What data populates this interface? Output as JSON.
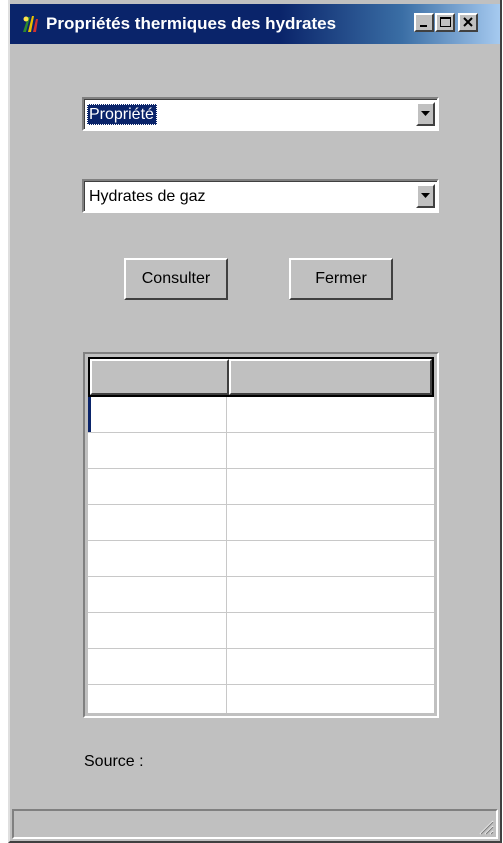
{
  "window": {
    "title": "Propriétés thermiques des hydrates",
    "icon": "app-logo-icon",
    "controls": [
      "minimize-icon",
      "maximize-icon",
      "close-icon"
    ]
  },
  "form": {
    "property_select": {
      "value": "Propriété",
      "selected": true
    },
    "category_select": {
      "value": "Hydrates de gaz"
    },
    "consult_button": "Consulter",
    "close_button": "Fermer"
  },
  "grid": {
    "headers": [
      "",
      ""
    ],
    "rows": [
      [
        "",
        ""
      ],
      [
        "",
        ""
      ],
      [
        "",
        ""
      ],
      [
        "",
        ""
      ],
      [
        "",
        ""
      ],
      [
        "",
        ""
      ],
      [
        "",
        ""
      ],
      [
        "",
        ""
      ],
      [
        "",
        ""
      ]
    ]
  },
  "footer": {
    "source_label": "Source :"
  },
  "colors": {
    "title_bar": "#0a246a",
    "face": "#c0c0c0",
    "selection": "#0a246a"
  }
}
